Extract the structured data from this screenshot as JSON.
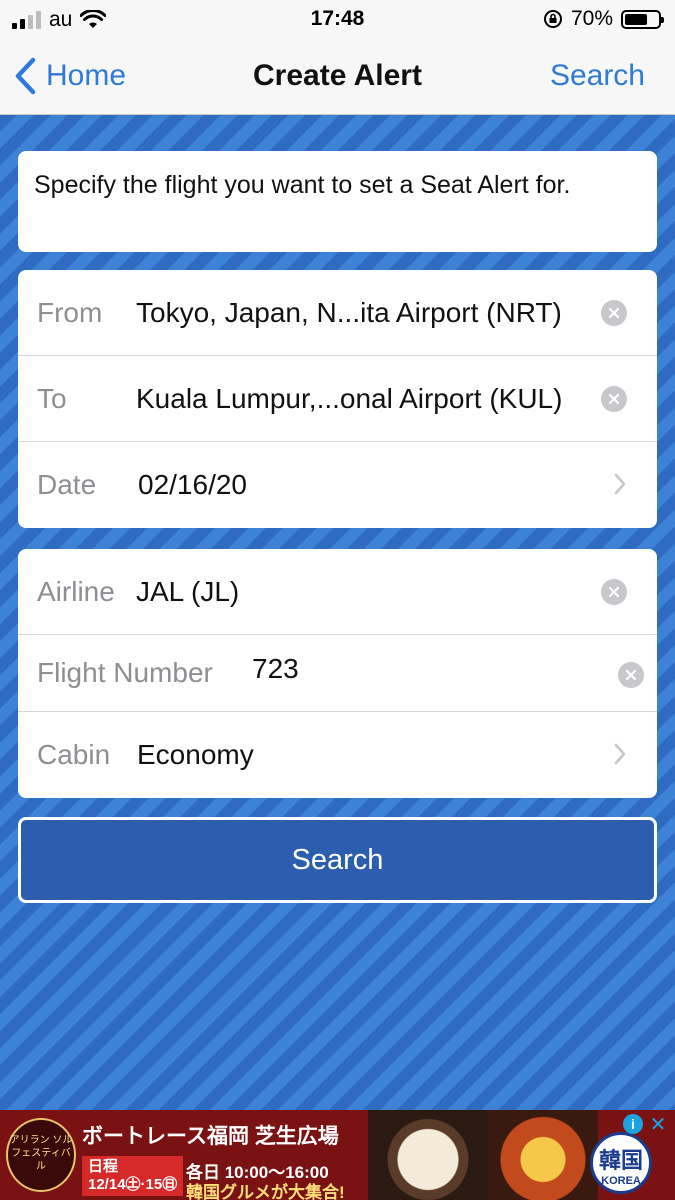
{
  "status_bar": {
    "carrier": "au",
    "time": "17:48",
    "battery_percent": "70%",
    "battery_level": 0.7,
    "signal_bars": 2,
    "icons": [
      "signal-icon",
      "wifi-icon",
      "orientation-lock-icon",
      "battery-icon"
    ]
  },
  "nav": {
    "back_label": "Home",
    "title": "Create Alert",
    "action_label": "Search"
  },
  "intro_text": "Specify the flight you want to set a Seat Alert for.",
  "route": {
    "from": {
      "label": "From",
      "value": "Tokyo, Japan, N...ita Airport (NRT)"
    },
    "to": {
      "label": "To",
      "value": "Kuala Lumpur,...onal Airport (KUL)"
    },
    "date": {
      "label": "Date",
      "value": "02/16/20"
    }
  },
  "flight": {
    "airline": {
      "label": "Airline",
      "value": "JAL (JL)"
    },
    "flight_number": {
      "label": "Flight Number",
      "value": "723"
    },
    "cabin": {
      "label": "Cabin",
      "value": "Economy"
    }
  },
  "search_button_label": "Search",
  "ad": {
    "logo_text": "アリラン ソル フェスティバル",
    "title": "ボートレース福岡 芝生広場",
    "date_tag_line1": "日程",
    "date_tag_line2": "12/14㊏·15㊐",
    "time": "各日 10:00～16:00",
    "tagline": "韓国グルメが大集合!",
    "badge_main": "韓国",
    "badge_sub": "KOREA",
    "info_symbol": "i",
    "close_symbol": "✕"
  },
  "colors": {
    "accent": "#2f7bd6",
    "background_stripe_dark": "#2e6bc1",
    "background_stripe_light": "#3e82d6",
    "button": "#2d5dae"
  }
}
